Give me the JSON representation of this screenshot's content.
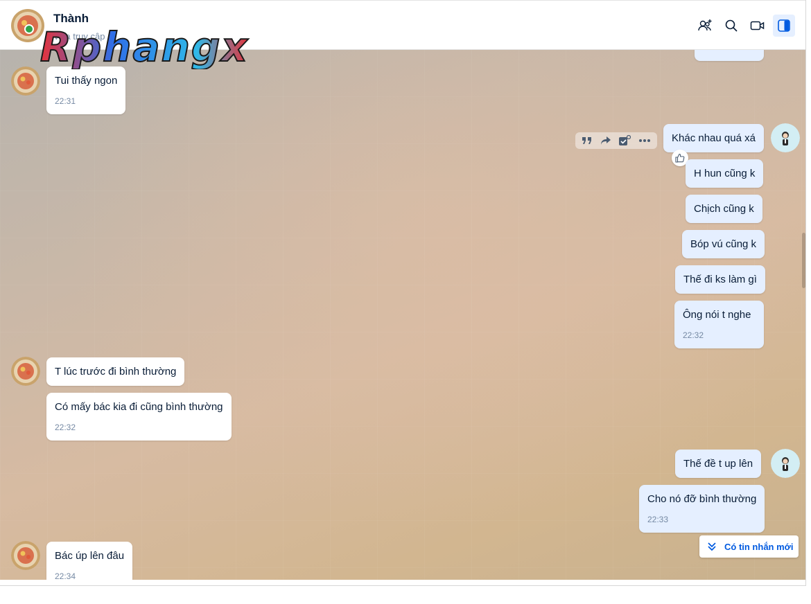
{
  "header": {
    "contact_name": "Thành",
    "status": "Vừa truy cập"
  },
  "watermark": {
    "text": "Rphangx"
  },
  "messages": [
    {
      "side": "in",
      "text": "Tui thấy ngon",
      "time": "22:31"
    },
    {
      "side": "out",
      "text": "Khác nhau quá xá"
    },
    {
      "side": "out",
      "text": "H hun cũng k"
    },
    {
      "side": "out",
      "text": "Chịch cũng k"
    },
    {
      "side": "out",
      "text": "Bóp vú cũng k"
    },
    {
      "side": "out",
      "text": "Thế đi ks làm gì"
    },
    {
      "side": "out",
      "text": "Ông nói t nghe",
      "time": "22:32"
    },
    {
      "side": "in",
      "text": "T lúc trước đi bình thường"
    },
    {
      "side": "in",
      "text": "Có mấy bác kia đi cũng bình thường",
      "time": "22:32"
    },
    {
      "side": "out",
      "text": "Thế đề t up lên"
    },
    {
      "side": "out",
      "text": "Cho nó đỡ bình thường",
      "time": "22:33"
    },
    {
      "side": "in",
      "text": "Bác úp lên đâu",
      "time": "22:34"
    }
  ],
  "new_messages_button": {
    "label": "Có tin nhắn mới"
  },
  "icons": {
    "header": [
      "add-member-icon",
      "search-icon",
      "video-call-icon",
      "sidebar-toggle-icon"
    ],
    "hover_toolbar": [
      "quote-icon",
      "forward-icon",
      "task-icon",
      "more-icon"
    ],
    "reaction": "thumbs-up-icon"
  },
  "colors": {
    "accent": "#005ae0",
    "outgoing_bubble": "#e5efff",
    "incoming_bubble": "#ffffff",
    "online": "#30a24a"
  }
}
